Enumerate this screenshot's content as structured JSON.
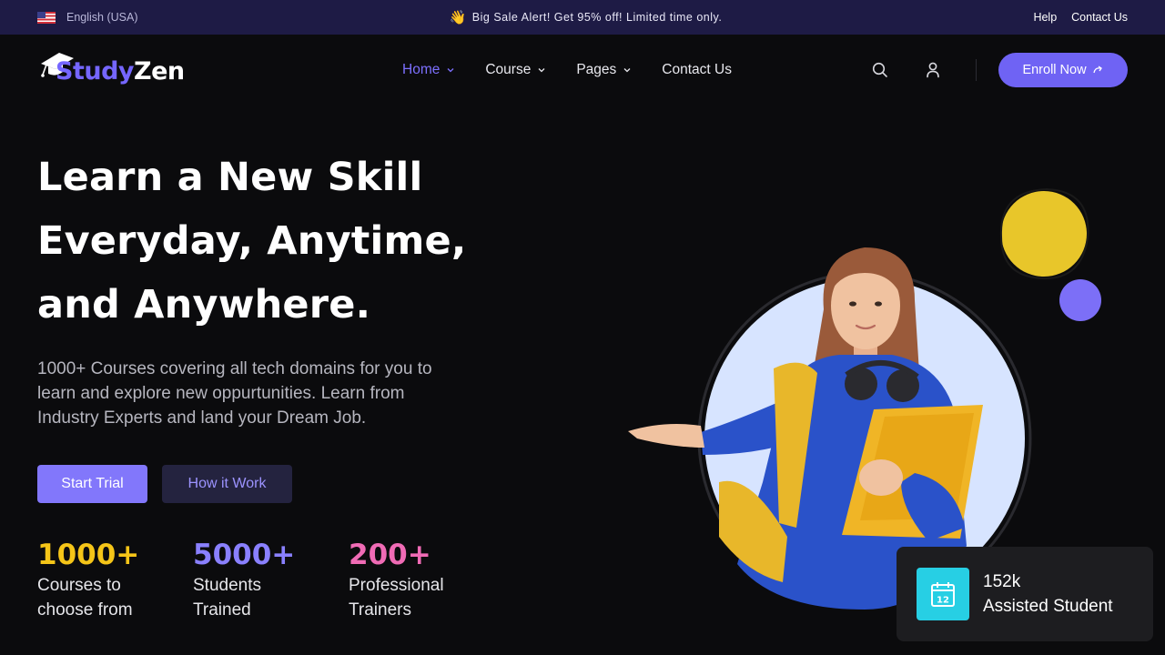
{
  "topbar": {
    "language": "English (USA)",
    "promo_emoji": "👋",
    "promo": "Big Sale Alert! Get 95% off! Limited time only.",
    "links": [
      "Help",
      "Contact Us"
    ]
  },
  "brand": {
    "name_part1": "Study",
    "name_part2": "Zen",
    "accent_color": "#7566ff"
  },
  "nav": {
    "items": [
      {
        "label": "Home",
        "active": true,
        "dropdown": true
      },
      {
        "label": "Course",
        "active": false,
        "dropdown": true
      },
      {
        "label": "Pages",
        "active": false,
        "dropdown": true
      },
      {
        "label": "Contact Us",
        "active": false,
        "dropdown": false
      }
    ]
  },
  "header": {
    "icons": [
      "search-icon",
      "user-icon"
    ],
    "enroll_label": "Enroll Now"
  },
  "hero": {
    "title_lines": [
      "Learn a New Skill",
      "Everyday, Anytime,",
      "and Anywhere."
    ],
    "description_lines": [
      "1000+ Courses covering all tech domains for you to",
      "learn and explore new oppurtunities. Learn from",
      "Industry Experts and land your Dream Job."
    ],
    "primary_cta": "Start Trial",
    "secondary_cta": "How it Work"
  },
  "stats": [
    {
      "value": "1000+",
      "label_lines": [
        "Courses to",
        "choose from"
      ],
      "color": "#f5c518"
    },
    {
      "value": "5000+",
      "label_lines": [
        "Students",
        "Trained"
      ],
      "color": "#8a80ff"
    },
    {
      "value": "200+",
      "label_lines": [
        "Professional",
        "Trainers"
      ],
      "color": "#f06bb5"
    }
  ],
  "assisted": {
    "icon": "calendar-icon",
    "calendar_day": "12",
    "count": "152k",
    "label": "Assisted Student"
  }
}
